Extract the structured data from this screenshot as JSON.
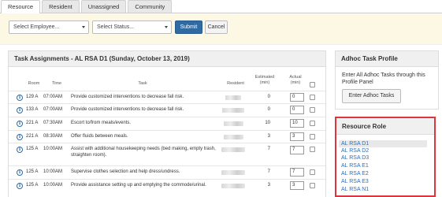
{
  "tabs": [
    {
      "label": "Resource",
      "active": true
    },
    {
      "label": "Resident",
      "active": false
    },
    {
      "label": "Unassigned",
      "active": false
    },
    {
      "label": "Community",
      "active": false
    }
  ],
  "filters": {
    "employee_placeholder": "Select Employee...",
    "status_placeholder": "Select Status...",
    "submit_label": "Submit",
    "cancel_label": "Cancel"
  },
  "tasks": {
    "title": "Task Assignments - AL RSA D1 (Sunday, October 13, 2019)",
    "columns": {
      "room": "Room",
      "time": "Time",
      "task": "Task",
      "resident": "Resident",
      "estimated": "Estimated (min)",
      "actual": "Actual (min)"
    },
    "rows": [
      {
        "room": "129 A",
        "time": "07:00AM",
        "task": "Provide customized interventions to decrease fall risk.",
        "estimated": "0",
        "actual": "0"
      },
      {
        "room": "133 A",
        "time": "07:00AM",
        "task": "Provide customized interventions to decrease fall risk.",
        "estimated": "0",
        "actual": "0"
      },
      {
        "room": "221 A",
        "time": "07:30AM",
        "task": "Escort to/from meals/events.",
        "estimated": "10",
        "actual": "10"
      },
      {
        "room": "221 A",
        "time": "08:30AM",
        "task": "Offer fluids between meals.",
        "estimated": "3",
        "actual": "3"
      },
      {
        "room": "125 A",
        "time": "10:00AM",
        "task": "Assist with additional housekeeping needs (bed making, empty trash, straighten room).",
        "estimated": "7",
        "actual": "7"
      },
      {
        "room": "125 A",
        "time": "10:00AM",
        "task": "Supervise clothes selection and help dress/undress.",
        "estimated": "7",
        "actual": "7"
      },
      {
        "room": "125 A",
        "time": "10:00AM",
        "task": "Provide assistance setting up and emptying the commode/urinal.",
        "estimated": "3",
        "actual": "3"
      }
    ]
  },
  "adhoc": {
    "title": "Adhoc Task Profile",
    "description": "Enter All Adhoc Tasks through this Profile Panel",
    "button_label": "Enter Adhoc Tasks"
  },
  "roles": {
    "title": "Resource Role",
    "items": [
      "AL RSA D1",
      "AL RSA D2",
      "AL RSA D3",
      "AL RSA E1",
      "AL RSA E2",
      "AL RSA E3",
      "AL RSA N1"
    ],
    "selected_index": 0
  },
  "colors": {
    "accent": "#2f6aa3",
    "link": "#2a6ebb",
    "highlight_border": "#d9363e",
    "filter_bg": "#fcf8e3"
  }
}
